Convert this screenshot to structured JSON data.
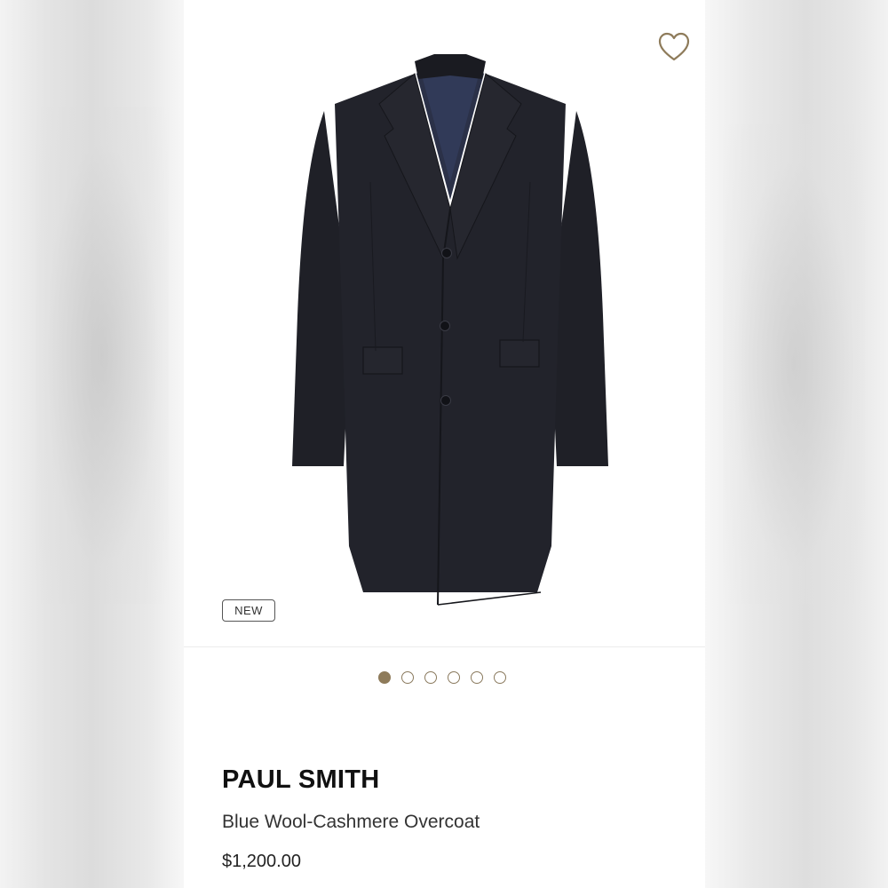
{
  "product": {
    "badge": "NEW",
    "brand": "PAUL SMITH",
    "name": "Blue Wool-Cashmere Overcoat",
    "price": "$1,200.00"
  },
  "gallery": {
    "image_count": 6,
    "active_index": 0
  },
  "icons": {
    "wishlist": "heart-outline-icon"
  },
  "colors": {
    "accent": "#8e7b5a",
    "coat": "#1e1f26"
  }
}
